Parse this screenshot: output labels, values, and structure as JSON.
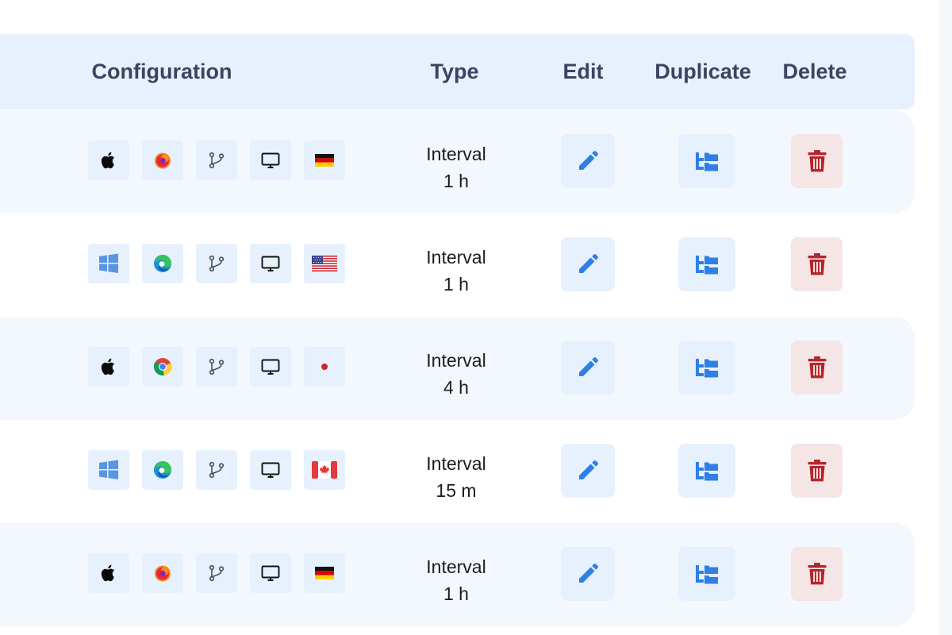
{
  "header": {
    "configuration": "Configuration",
    "type": "Type",
    "edit": "Edit",
    "duplicate": "Duplicate",
    "delete": "Delete"
  },
  "rows": [
    {
      "os": "apple",
      "browser": "firefox",
      "branch": "branch",
      "device": "desktop",
      "region": "germany",
      "type": "Interval",
      "interval": "1 h"
    },
    {
      "os": "windows",
      "browser": "edge",
      "branch": "branch",
      "device": "desktop",
      "region": "usa",
      "type": "Interval",
      "interval": "1 h"
    },
    {
      "os": "apple",
      "browser": "chrome",
      "branch": "branch",
      "device": "desktop",
      "region": "japan",
      "type": "Interval",
      "interval": "4 h"
    },
    {
      "os": "windows",
      "browser": "edge",
      "branch": "branch",
      "device": "desktop",
      "region": "canada",
      "type": "Interval",
      "interval": "15 m"
    },
    {
      "os": "apple",
      "browser": "firefox",
      "branch": "branch",
      "device": "desktop",
      "region": "germany",
      "type": "Interval",
      "interval": "1 h"
    }
  ],
  "colors": {
    "header_bg": "#e7f1fd",
    "row_alt_bg": "#f3f8fe",
    "accent_blue": "#2f7fe6",
    "delete_red": "#b3262c",
    "delete_bg": "#f6e5e5",
    "header_text": "#3f4260"
  },
  "icons": {
    "edit": "pencil-icon",
    "duplicate": "folder-tree-icon",
    "delete": "trash-icon"
  }
}
